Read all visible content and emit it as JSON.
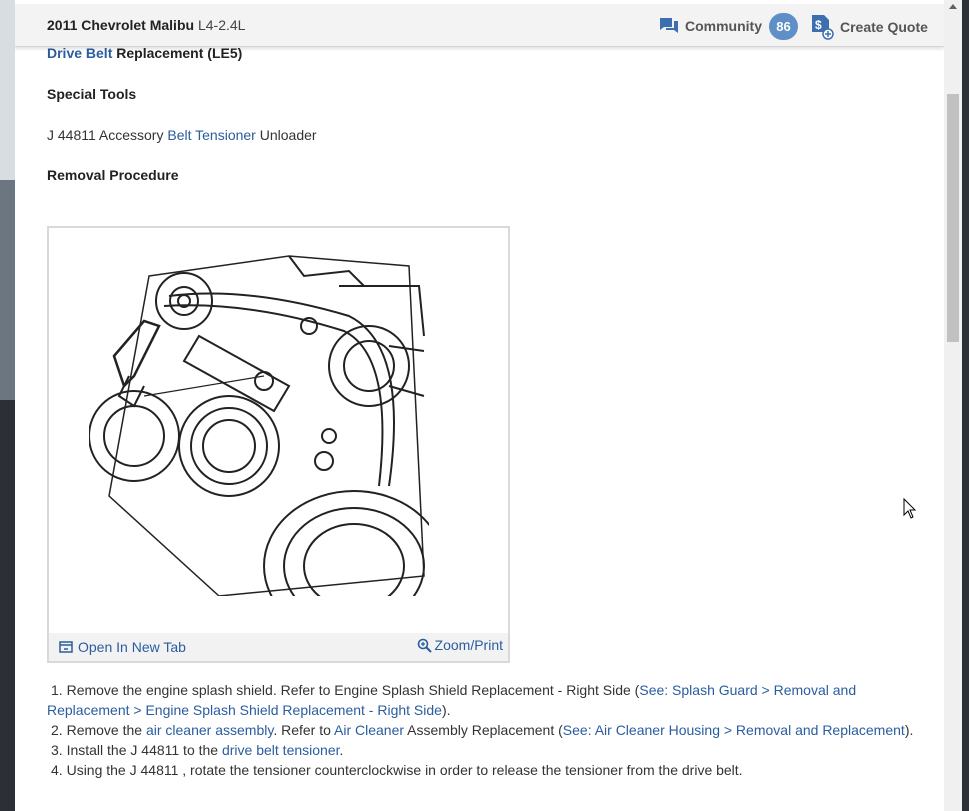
{
  "header": {
    "vehicle": "2011 Chevrolet Malibu",
    "engine": "L4-2.4L",
    "community_label": "Community",
    "community_count": "86",
    "create_quote_label": "Create Quote"
  },
  "content": {
    "title_link": "Drive Belt",
    "title_rest": " Replacement (LE5)",
    "special_tools_heading": "Special Tools",
    "tool_prefix": "J 44811 Accessory ",
    "tool_link": "Belt Tensioner",
    "tool_suffix": " Unloader",
    "removal_heading": "Removal Procedure",
    "figure": {
      "open_tab_label": "Open In New Tab",
      "zoom_label": "Zoom/Print"
    },
    "steps": [
      {
        "num": "1.",
        "t1": " Remove the engine splash shield. Refer to Engine Splash Shield Replacement - Right Side (",
        "link1": "See: Splash Guard > Removal and Replacement > Engine Splash Shield Replacement - Right Side",
        "t2": ")."
      },
      {
        "num": "2.",
        "t1": " Remove the ",
        "link1": "air cleaner assembly",
        "t2": ". Refer to ",
        "link2": "Air Cleaner",
        "t3": " Assembly Replacement (",
        "link3": "See: Air Cleaner Housing > Removal and Replacement",
        "t4": ")."
      },
      {
        "num": "3.",
        "t1": " Install the J 44811 to the ",
        "link1": "drive belt tensioner",
        "t2": "."
      },
      {
        "num": "4.",
        "t1": " Using the J 44811 , rotate the tensioner counterclockwise in order to release the tensioner from the drive belt."
      }
    ]
  },
  "colors": {
    "link": "#2a5d9f",
    "badge": "#5f8fc7",
    "header_bg": "#f3f3f3"
  },
  "icons": [
    "chat-bubbles-icon",
    "quote-document-dollar-icon",
    "open-new-tab-icon",
    "zoom-in-icon",
    "mouse-cursor-icon"
  ]
}
